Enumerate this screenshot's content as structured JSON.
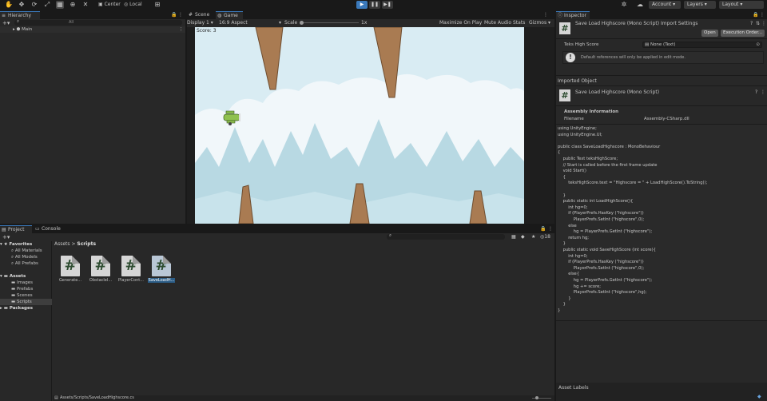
{
  "toolbar": {
    "center_label": "Center",
    "local_label": "Local",
    "account_label": "Account",
    "layers_label": "Layers",
    "layout_label": "Layout"
  },
  "hierarchy": {
    "tab_label": "Hierarchy",
    "search_placeholder": "All",
    "root_item": "Main"
  },
  "scene_view": {
    "tab_scene": "Scene",
    "tab_game": "Game",
    "display_label": "Display 1",
    "aspect_label": "16:9 Aspect",
    "scale_label": "Scale",
    "scale_value": "1x",
    "maximize_label": "Maximize On Play",
    "mute_label": "Mute Audio",
    "stats_label": "Stats",
    "gizmos_label": "Gizmos",
    "score_text": "Score: 3"
  },
  "project": {
    "tab_project": "Project",
    "tab_console": "Console",
    "favorites_label": "Favorites",
    "favorites": [
      "All Materials",
      "All Models",
      "All Prefabs"
    ],
    "assets_label": "Assets",
    "asset_folders": [
      "Images",
      "Prefabs",
      "Scenes",
      "Scripts"
    ],
    "packages_label": "Packages",
    "breadcrumb_root": "Assets",
    "breadcrumb_sep": ">",
    "breadcrumb_current": "Scripts",
    "count_label": "18",
    "files": [
      {
        "name": "Generate..."
      },
      {
        "name": "ObstacleI..."
      },
      {
        "name": "PlayerCont..."
      },
      {
        "name": "SaveLoadH..."
      }
    ],
    "footer_path": "Assets/Scripts/SaveLoadHighscore.cs"
  },
  "inspector": {
    "tab_label": "Inspector",
    "title": "Save Load Highscore (Mono Script) Import Settings",
    "open_label": "Open",
    "execution_order_label": "Execution Order...",
    "field_label": "Teks High Score",
    "field_value": "None (Text)",
    "info_text": "Default references will only be applied in edit mode.",
    "imported_object_label": "Imported Object",
    "script_title": "Save Load Highscore (Mono Script)",
    "assembly_info_label": "Assembly Information",
    "filename_label": "Filename",
    "filename_value": "Assembly-CSharp.dll",
    "code_lines": [
      "using UnityEngine;",
      "using UnityEngine.UI;",
      "",
      "public class SaveLoadHighscore : MonoBehaviour",
      "{",
      "    public Text teksHighScore;",
      "    // Start is called before the first frame update",
      "    void Start()",
      "    {",
      "        teksHighScore.text = \"Highscore = \" + LoadHighScore().ToString();",
      "",
      "    }",
      "    public static int LoadHighScore(){",
      "        int hg=0;",
      "        if (PlayerPrefs.HasKey (\"highscore\"))",
      "            PlayerPrefs.SetInt (\"highscore\",0);",
      "        else",
      "            hg = PlayerPrefs.GetInt (\"highscore\");",
      "        return hg;",
      "    }",
      "    public static void SaveHighScore (int score){",
      "        int hg=0;",
      "        if (PlayerPrefs.HasKey (\"highscore\"))",
      "            PlayerPrefs.SetInt (\"highscore\",0);",
      "        else{",
      "            hg = PlayerPrefs.GetInt (\"highscore\");",
      "            hg += score;",
      "            PlayerPrefs.SetInt (\"highscore\",hg);",
      "        }",
      "    }",
      "}"
    ],
    "asset_labels_label": "Asset Labels"
  },
  "colors": {
    "sky": "#dcedf5",
    "pipe": "#a97b52",
    "accent": "#3a79bb"
  }
}
